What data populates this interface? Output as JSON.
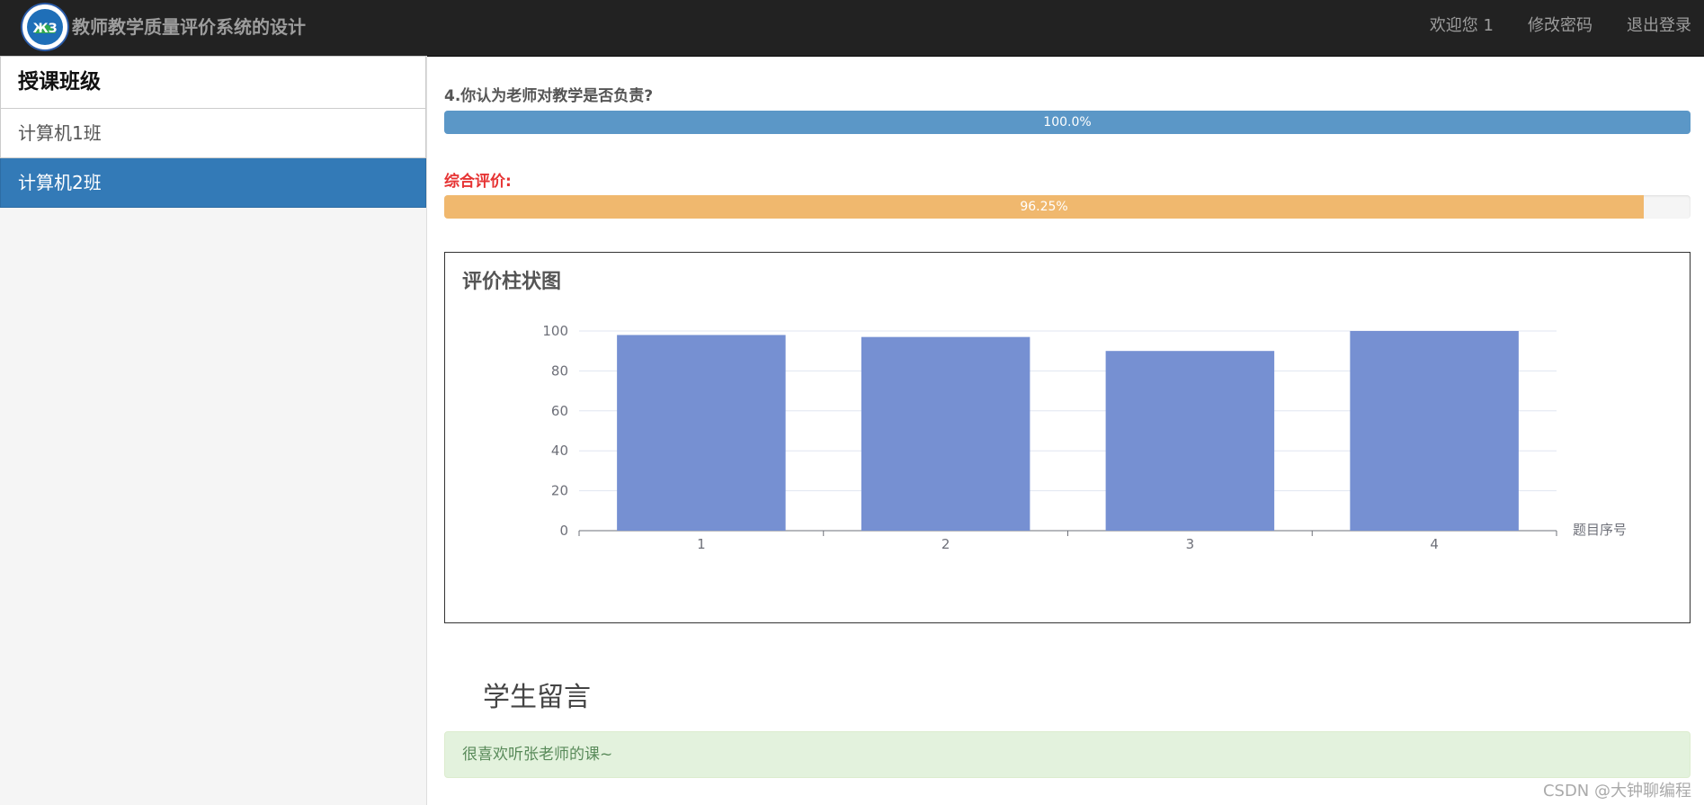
{
  "navbar": {
    "brand": "教师教学质量评价系统的设计",
    "links": [
      "欢迎您 1",
      "修改密码",
      "退出登录"
    ]
  },
  "sidebar": {
    "title": "授课班级",
    "items": [
      {
        "label": "计算机1班",
        "active": false
      },
      {
        "label": "计算机2班",
        "active": true
      }
    ]
  },
  "question4": {
    "title": "4.你认为老师对教学是否负责?",
    "percent_label": "100.0%",
    "value": 1.0
  },
  "overall": {
    "title": "综合评价:",
    "percent_label": "96.25%",
    "value": 0.9625
  },
  "chart_panel": {
    "title": "评价柱状图"
  },
  "chart_data": {
    "type": "bar",
    "categories": [
      "1",
      "2",
      "3",
      "4"
    ],
    "values": [
      98,
      97,
      90,
      100
    ],
    "xlabel": "题目序号",
    "ylabel": "",
    "ylim": [
      0,
      100
    ],
    "yticks": [
      0,
      20,
      40,
      60,
      80,
      100
    ],
    "color": "#7690d2",
    "grid": true
  },
  "messages": {
    "title": "学生留言",
    "items": [
      "很喜欢听张老师的课~"
    ]
  },
  "watermark": "CSDN @大钟聊编程",
  "colors": {
    "navbar": "#222222",
    "active": "#337ab7",
    "progress_blue": "#5b97c7",
    "progress_orange": "#f0b86e",
    "accent_red": "#e63333"
  }
}
